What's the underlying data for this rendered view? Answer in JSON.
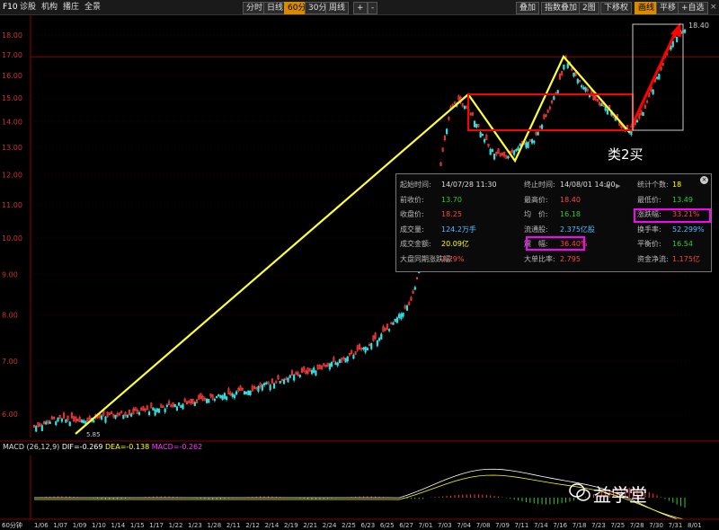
{
  "toolbar": {
    "code": "F10",
    "links": [
      "诊股",
      "机构",
      "播庄",
      "全景"
    ],
    "periods": [
      "分时",
      "日线",
      "60分",
      "30分",
      "周线"
    ],
    "active_period": "60分",
    "plus": "+",
    "minus": "-",
    "right_buttons": [
      "叠加",
      "指数叠加",
      "2图",
      "下移权",
      "画线",
      "平移",
      "+自选"
    ],
    "close": "×"
  },
  "chart": {
    "price_labels": [
      "18.00",
      "17.00",
      "16.00",
      "15.00",
      "14.00",
      "13.00",
      "12.00",
      "11.00",
      "10.00",
      "9.00",
      "8.00",
      "7.00",
      "6.00"
    ],
    "price_values": [
      18,
      17,
      16,
      15,
      14,
      13,
      12,
      11,
      10,
      9,
      8,
      7,
      6
    ],
    "high_label": "18.40",
    "low_label": "5.85",
    "annotation": "类2买",
    "date_labels": [
      "1/06",
      "1/07",
      "1/09",
      "1/10",
      "1/14",
      "1/15",
      "1/17",
      "1/22",
      "1/23",
      "1/28",
      "2/11",
      "2/12",
      "2/14",
      "2/19",
      "2/21",
      "2/24",
      "2/25",
      "6/23",
      "6/25",
      "6/27",
      "7/01",
      "7/03",
      "7/04",
      "7/08",
      "7/09",
      "7/11",
      "7/14",
      "7/16",
      "7/18",
      "7/23",
      "7/25",
      "7/28",
      "7/30",
      "7/31",
      "8/01"
    ],
    "period_tag": "60分钟",
    "colors": {
      "up": "#ff3b3b",
      "down": "#33e0e0",
      "zigzag": "#ffff33",
      "box": "#ff0000",
      "arrow": "#ff0000",
      "highlight": "#ff00ff"
    }
  },
  "macd": {
    "label": "MACD",
    "params": "(26,12,9)",
    "dif": "DIF=-0.269",
    "dea": "DEA=-0.138",
    "macd": "MACD=-0.262"
  },
  "popup": {
    "rows": [
      [
        {
          "l": "起始时间:",
          "v": "14/07/28 11:30"
        },
        {
          "l": "终止时间:",
          "v": "14/08/01 14:00"
        },
        {
          "l": "统计个数:",
          "v": "18"
        }
      ],
      [
        {
          "l": "前收价:",
          "v": "13.70"
        },
        {
          "l": "最高价:",
          "v": "18.40"
        },
        {
          "l": "最低价:",
          "v": "13.49"
        }
      ],
      [
        {
          "l": "收盘价:",
          "v": "18.25"
        },
        {
          "l": "均　价:",
          "v": "16.18"
        },
        {
          "l": "涨跌幅:",
          "v": "33.21%"
        }
      ],
      [
        {
          "l": "成交量:",
          "v": "124.2万手"
        },
        {
          "l": "流通股:",
          "v": "2.375亿股"
        },
        {
          "l": "换手率:",
          "v": "52.299%"
        }
      ],
      [
        {
          "l": "成交金额:",
          "v": "20.09亿"
        },
        {
          "l": "震　幅:",
          "v": "36.40%"
        },
        {
          "l": "平衡价:",
          "v": "16.54"
        }
      ],
      [
        {
          "l": "大盘同期涨跌幅:",
          "v": "2.79%"
        },
        {
          "l": "大单比率:",
          "v": "2.795"
        },
        {
          "l": "资金净流:",
          "v": "1.175亿"
        }
      ]
    ],
    "close": "×"
  },
  "watermark": "益学堂"
}
